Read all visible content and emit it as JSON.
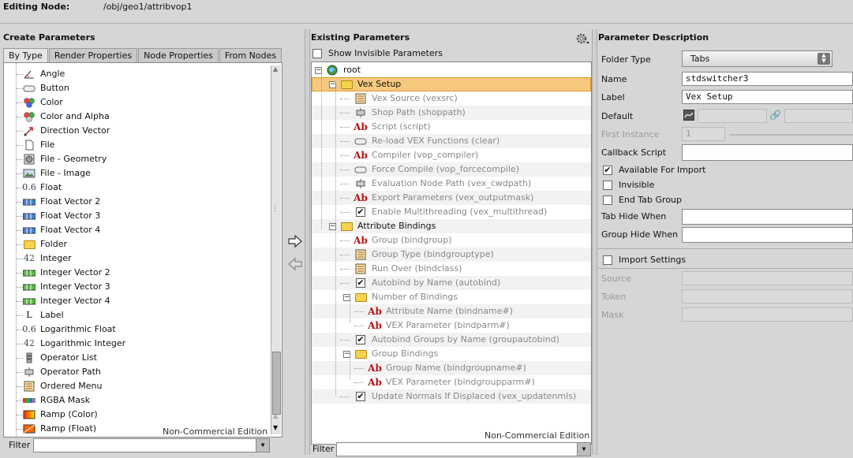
{
  "header": {
    "label": "Editing Node:",
    "path": "/obj/geo1/attribvop1"
  },
  "create": {
    "title": "Create Parameters",
    "tabs": [
      "By Type",
      "Render Properties",
      "Node Properties",
      "From Nodes"
    ],
    "items": [
      {
        "label": "Angle",
        "icon": "angle-icon"
      },
      {
        "label": "Button",
        "icon": "button-icon"
      },
      {
        "label": "Color",
        "icon": "color-icon"
      },
      {
        "label": "Color and Alpha",
        "icon": "color-alpha-icon"
      },
      {
        "label": "Direction Vector",
        "icon": "direction-vector-icon"
      },
      {
        "label": "File",
        "icon": "file-icon"
      },
      {
        "label": "File - Geometry",
        "icon": "file-geometry-icon"
      },
      {
        "label": "File - Image",
        "icon": "file-image-icon"
      },
      {
        "label": "Float",
        "icon": "float-icon",
        "glyph": "0.6"
      },
      {
        "label": "Float Vector 2",
        "icon": "float-vector-icon"
      },
      {
        "label": "Float Vector 3",
        "icon": "float-vector-icon"
      },
      {
        "label": "Float Vector 4",
        "icon": "float-vector-icon"
      },
      {
        "label": "Folder",
        "icon": "folder-icon"
      },
      {
        "label": "Integer",
        "icon": "integer-icon",
        "glyph": "42"
      },
      {
        "label": "Integer Vector 2",
        "icon": "integer-vector-icon"
      },
      {
        "label": "Integer Vector 3",
        "icon": "integer-vector-icon"
      },
      {
        "label": "Integer Vector 4",
        "icon": "integer-vector-icon"
      },
      {
        "label": "Label",
        "icon": "label-icon",
        "glyph": "L"
      },
      {
        "label": "Logarithmic Float",
        "icon": "log-float-icon",
        "glyph": "0.6"
      },
      {
        "label": "Logarithmic Integer",
        "icon": "log-integer-icon",
        "glyph": "42"
      },
      {
        "label": "Operator List",
        "icon": "operator-list-icon"
      },
      {
        "label": "Operator Path",
        "icon": "operator-path-icon"
      },
      {
        "label": "Ordered Menu",
        "icon": "ordered-menu-icon"
      },
      {
        "label": "RGBA Mask",
        "icon": "rgba-mask-icon"
      },
      {
        "label": "Ramp (Color)",
        "icon": "ramp-color-icon"
      },
      {
        "label": "Ramp (Float)",
        "icon": "ramp-float-icon"
      }
    ],
    "watermark": "Non-Commercial Edition",
    "filter_label": "Filter"
  },
  "existing": {
    "title": "Existing Parameters",
    "show_invisible": "Show Invisible Parameters",
    "tree": [
      {
        "label": "root",
        "depth": 0,
        "icon": "root-globe-icon",
        "kind": "root",
        "expander": "-"
      },
      {
        "label": "Vex Setup",
        "depth": 1,
        "icon": "folder-icon",
        "kind": "folder",
        "expander": "-",
        "selected": true
      },
      {
        "label": "Vex Source (vexsrc)",
        "depth": 2,
        "icon": "ordered-menu-icon",
        "grey": true
      },
      {
        "label": "Shop Path (shoppath)",
        "depth": 2,
        "icon": "operator-path-icon",
        "grey": true
      },
      {
        "label": "Script (script)",
        "depth": 2,
        "icon": "string-icon",
        "grey": true
      },
      {
        "label": "Re-load VEX Functions (clear)",
        "depth": 2,
        "icon": "button-icon",
        "grey": true
      },
      {
        "label": "Compiler (vop_compiler)",
        "depth": 2,
        "icon": "string-icon",
        "grey": true
      },
      {
        "label": "Force Compile (vop_forcecompile)",
        "depth": 2,
        "icon": "button-icon",
        "grey": true
      },
      {
        "label": "Evaluation Node Path (vex_cwdpath)",
        "depth": 2,
        "icon": "operator-path-icon",
        "grey": true
      },
      {
        "label": "Export Parameters (vex_outputmask)",
        "depth": 2,
        "icon": "string-icon",
        "grey": true
      },
      {
        "label": "Enable Multithreading (vex_multithread)",
        "depth": 2,
        "icon": "toggle-icon",
        "grey": true
      },
      {
        "label": "Attribute Bindings",
        "depth": 1,
        "icon": "folder-icon",
        "kind": "folder",
        "expander": "-"
      },
      {
        "label": "Group (bindgroup)",
        "depth": 2,
        "icon": "string-icon",
        "grey": true
      },
      {
        "label": "Group Type (bindgrouptype)",
        "depth": 2,
        "icon": "ordered-menu-icon",
        "grey": true
      },
      {
        "label": "Run Over (bindclass)",
        "depth": 2,
        "icon": "ordered-menu-icon",
        "grey": true
      },
      {
        "label": "Autobind by Name (autobind)",
        "depth": 2,
        "icon": "toggle-icon",
        "grey": true
      },
      {
        "label": "Number of Bindings",
        "depth": 2,
        "icon": "folder-icon",
        "kind": "folder",
        "expander": "-",
        "grey": true
      },
      {
        "label": "Attribute Name (bindname#)",
        "depth": 3,
        "icon": "string-icon",
        "grey": true
      },
      {
        "label": "VEX Parameter (bindparm#)",
        "depth": 3,
        "icon": "string-icon",
        "grey": true
      },
      {
        "label": "Autobind Groups by Name (groupautobind)",
        "depth": 2,
        "icon": "toggle-icon",
        "grey": true
      },
      {
        "label": "Group Bindings",
        "depth": 2,
        "icon": "folder-icon",
        "kind": "folder",
        "expander": "-",
        "grey": true
      },
      {
        "label": "Group Name (bindgroupname#)",
        "depth": 3,
        "icon": "string-icon",
        "grey": true
      },
      {
        "label": "VEX Parameter (bindgroupparm#)",
        "depth": 3,
        "icon": "string-icon",
        "grey": true
      },
      {
        "label": "Update Normals If Displaced (vex_updatenmls)",
        "depth": 2,
        "icon": "toggle-icon",
        "grey": true
      }
    ],
    "watermark": "Non-Commercial Edition",
    "filter_label": "Filter"
  },
  "desc": {
    "title": "Parameter Description",
    "folder_type_label": "Folder Type",
    "folder_type_value": "Tabs",
    "name_label": "Name",
    "name_value": "stdswitcher3",
    "label_label": "Label",
    "label_value": "Vex Setup",
    "default_label": "Default",
    "first_instance_label": "First Instance",
    "first_instance_value": "1",
    "callback_label": "Callback Script",
    "available_import": "Available For Import",
    "invisible": "Invisible",
    "end_tab_group": "End Tab Group",
    "tab_hide_when": "Tab Hide When",
    "group_hide_when": "Group Hide When",
    "import_settings": "Import Settings",
    "source_label": "Source",
    "token_label": "Token",
    "mask_label": "Mask"
  },
  "colors": {
    "selection": "#f7c97e",
    "selection_border": "#d99a2b",
    "string_red": "#b11111"
  }
}
